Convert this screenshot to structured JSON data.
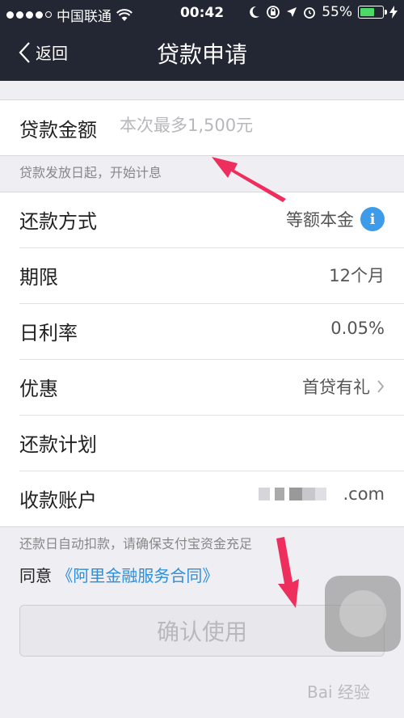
{
  "status_bar": {
    "carrier": "中国联通",
    "time": "00:42",
    "battery": "55%"
  },
  "navbar": {
    "back_label": "返回",
    "title": "贷款申请"
  },
  "loan": {
    "label": "贷款金额",
    "placeholder": "本次最多1,500元",
    "note": "贷款发放日起，开始计息"
  },
  "details": {
    "repay_method_label": "还款方式",
    "repay_method_value": "等额本金",
    "term_label": "期限",
    "term_value": "12个月",
    "rate_label": "日利率",
    "rate_value": "0.05%",
    "discount_label": "优惠",
    "discount_value": "首贷有礼",
    "plan_label": "还款计划",
    "account_label": "收款账户",
    "account_value_suffix": ".com"
  },
  "auto_debit_note": "还款日自动扣款，请确保支付宝资金充足",
  "agreement": {
    "prefix": "同意",
    "link": "《阿里金融服务合同》"
  },
  "confirm_label": "确认使用",
  "watermark": "Bai 经验",
  "colors": {
    "nav_bg": "#222733",
    "info_blue": "#3d9bea",
    "link_blue": "#2b8fd9",
    "arrow": "#ee2f5e"
  }
}
